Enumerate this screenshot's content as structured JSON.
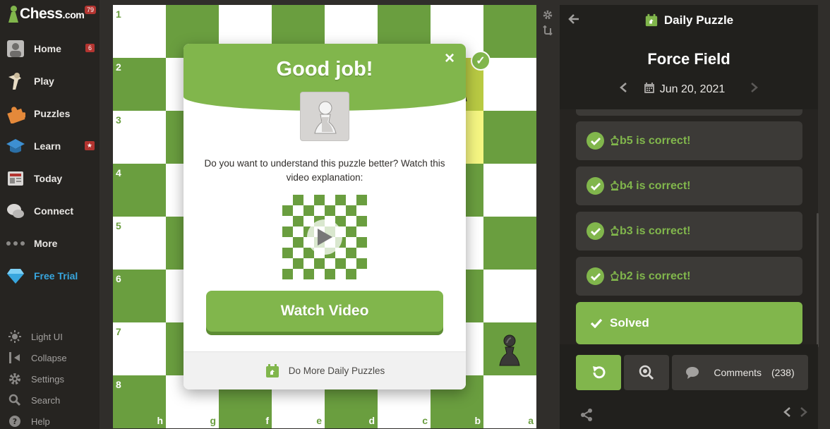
{
  "app": {
    "logo_text": "Chess",
    "logo_suffix": ".com",
    "notification_count": "79"
  },
  "sidebar": {
    "items": [
      {
        "label": "Home",
        "badge": "6"
      },
      {
        "label": "Play",
        "badge": ""
      },
      {
        "label": "Puzzles",
        "badge": ""
      },
      {
        "label": "Learn",
        "badge": "★"
      },
      {
        "label": "Today",
        "badge": ""
      },
      {
        "label": "Connect",
        "badge": ""
      },
      {
        "label": "More",
        "badge": ""
      },
      {
        "label": "Free Trial",
        "badge": ""
      }
    ],
    "bottom_items": [
      {
        "label": "Light UI",
        "icon": "sun-icon"
      },
      {
        "label": "Collapse",
        "icon": "collapse-icon"
      },
      {
        "label": "Settings",
        "icon": "gear-icon"
      },
      {
        "label": "Search",
        "icon": "search-icon"
      },
      {
        "label": "Help",
        "icon": "help-icon"
      }
    ]
  },
  "board": {
    "ranks": [
      "1",
      "2",
      "3",
      "4",
      "5",
      "6",
      "7",
      "8"
    ],
    "files": [
      "h",
      "g",
      "f",
      "e",
      "d",
      "c",
      "b",
      "a"
    ],
    "orientation": "black",
    "colors": {
      "light": "#ffffff",
      "dark": "#6a9e3f",
      "highlight_light": "#f5f682",
      "highlight_dark": "#b9ca43"
    }
  },
  "modal": {
    "title": "Good job!",
    "close_label": "×",
    "description": "Do you want to understand this puzzle better? Watch this video explanation:",
    "watch_button": "Watch Video",
    "footer_link": "Do More Daily Puzzles"
  },
  "panel": {
    "header_title": "Daily Puzzle",
    "puzzle_name": "Force Field",
    "date": "Jun 20, 2021",
    "moves": [
      {
        "text": "b5 is correct!"
      },
      {
        "text": "b4 is correct!"
      },
      {
        "text": "b3 is correct!"
      },
      {
        "text": "b2 is correct!"
      }
    ],
    "solved_label": "Solved",
    "comments_label": "Comments",
    "comments_count": "(238)"
  },
  "colors": {
    "accent_green": "#81b64c",
    "badge_red": "#b33430",
    "trial_blue": "#38a6de"
  }
}
